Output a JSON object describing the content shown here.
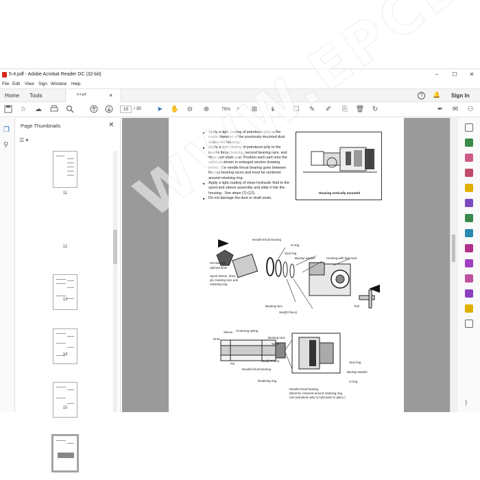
{
  "window": {
    "title": "5-4.pdf - Adobe Acrobat Reader DC (32-bit)",
    "minimize": "–",
    "maximize": "☐",
    "close": "✕"
  },
  "menu": [
    "File",
    "Edit",
    "View",
    "Sign",
    "Window",
    "Help"
  ],
  "tabs": {
    "home": "Home",
    "tools": "Tools",
    "document": "5-4.pdf",
    "close": "×",
    "help": "?",
    "sign_in": "Sign In"
  },
  "toolbar": {
    "page_current": "15",
    "page_total": "/ 35",
    "zoom": "75%"
  },
  "thumbnails": {
    "title": "Page Thumbnails",
    "close": "✕",
    "options": "☰ ▾",
    "pages": [
      "11",
      "12",
      "13",
      "14",
      "15"
    ],
    "selected": "15"
  },
  "document": {
    "bullets": [
      "Apply a light coating of petroleum jelly to the inside diameter of the previously mounted dust seal in the housing.",
      "Apply a light coating of petroleum jelly to the needle thrust bearing, second bearing race, and three part shaft seal. Position each part onto the spool as shown in enlarged section drawing below. The needle thrust bearing goes between the two bearing races and must be centered around retaining ring.",
      "Apply a light coating of clean hydraulic fluid to the spool and sleeve assembly and slide it into the housing . See steps (7)-(12).",
      "Do not damage the dust or shaft seals."
    ],
    "figure1_caption": "Housing vertically mounted",
    "fig2_labels": {
      "needle_thrust_bearing": "Needle thrust bearing",
      "oring": "O-ring",
      "seal_ring": "Seal ring",
      "backup_washer": "Backup washer",
      "housing_dust_seal": "Housing with dust seal",
      "gerotor": "Gerotor star",
      "splined": "Splined drive",
      "spool_sleeve": "Spool sleeve, drive,",
      "pin_bearing": "pin, bearing race and",
      "retaining_ring": "retaining ring",
      "bearing_race": "Bearing race",
      "seal_3piece": "Seal(3 Piece)",
      "tool": "Tool"
    },
    "fig3_labels": {
      "sleeve": "Sleeve",
      "centering_spring": "Centering spring",
      "drive": "Drive",
      "bearing_race": "Bearing race",
      "spool": "Spool",
      "pin": "Pin",
      "seal_3piece": "Seal(3 Piece)",
      "needle_thrust": "Needle thrust bearing",
      "seal_ring": "Seal ring",
      "backup_washer": "Backup washer",
      "retaining_ring": "Retaining ring",
      "oring": "O-ring",
      "note1": "Needle thrust bearing",
      "note2": "(Must be centered around retaining ring.",
      "note3": "Use petroleum jelly to hold parts in place.)"
    }
  },
  "watermark": "WWW.EPCDEPO.COM"
}
